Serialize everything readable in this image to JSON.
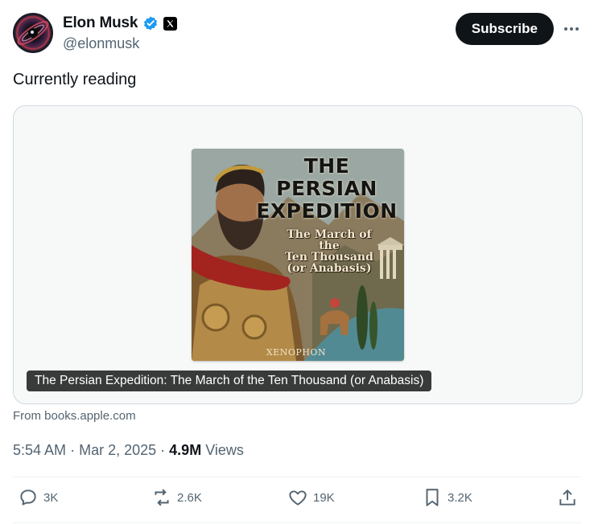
{
  "author": {
    "display_name": "Elon Musk",
    "handle": "@elonmusk",
    "verified_color": "#1d9bf0"
  },
  "header": {
    "subscribe_label": "Subscribe"
  },
  "tweet": {
    "text": "Currently reading"
  },
  "card": {
    "cover": {
      "title_lines": [
        "THE",
        "PERSIAN",
        "EXPEDITION"
      ],
      "subtitle_lines": [
        "The March of",
        "the",
        "Ten Thousand",
        "(or Anabasis)"
      ],
      "author": "XENOPHON"
    },
    "title": "The Persian Expedition: The March of the Ten Thousand (or Anabasis)",
    "source": "From books.apple.com"
  },
  "meta": {
    "time": "5:54 AM",
    "date": "Mar 2, 2025",
    "views_count": "4.9M",
    "views_label": "Views",
    "separator": "·"
  },
  "actions": {
    "replies": "3K",
    "reposts": "2.6K",
    "likes": "19K",
    "bookmarks": "3.2K"
  }
}
